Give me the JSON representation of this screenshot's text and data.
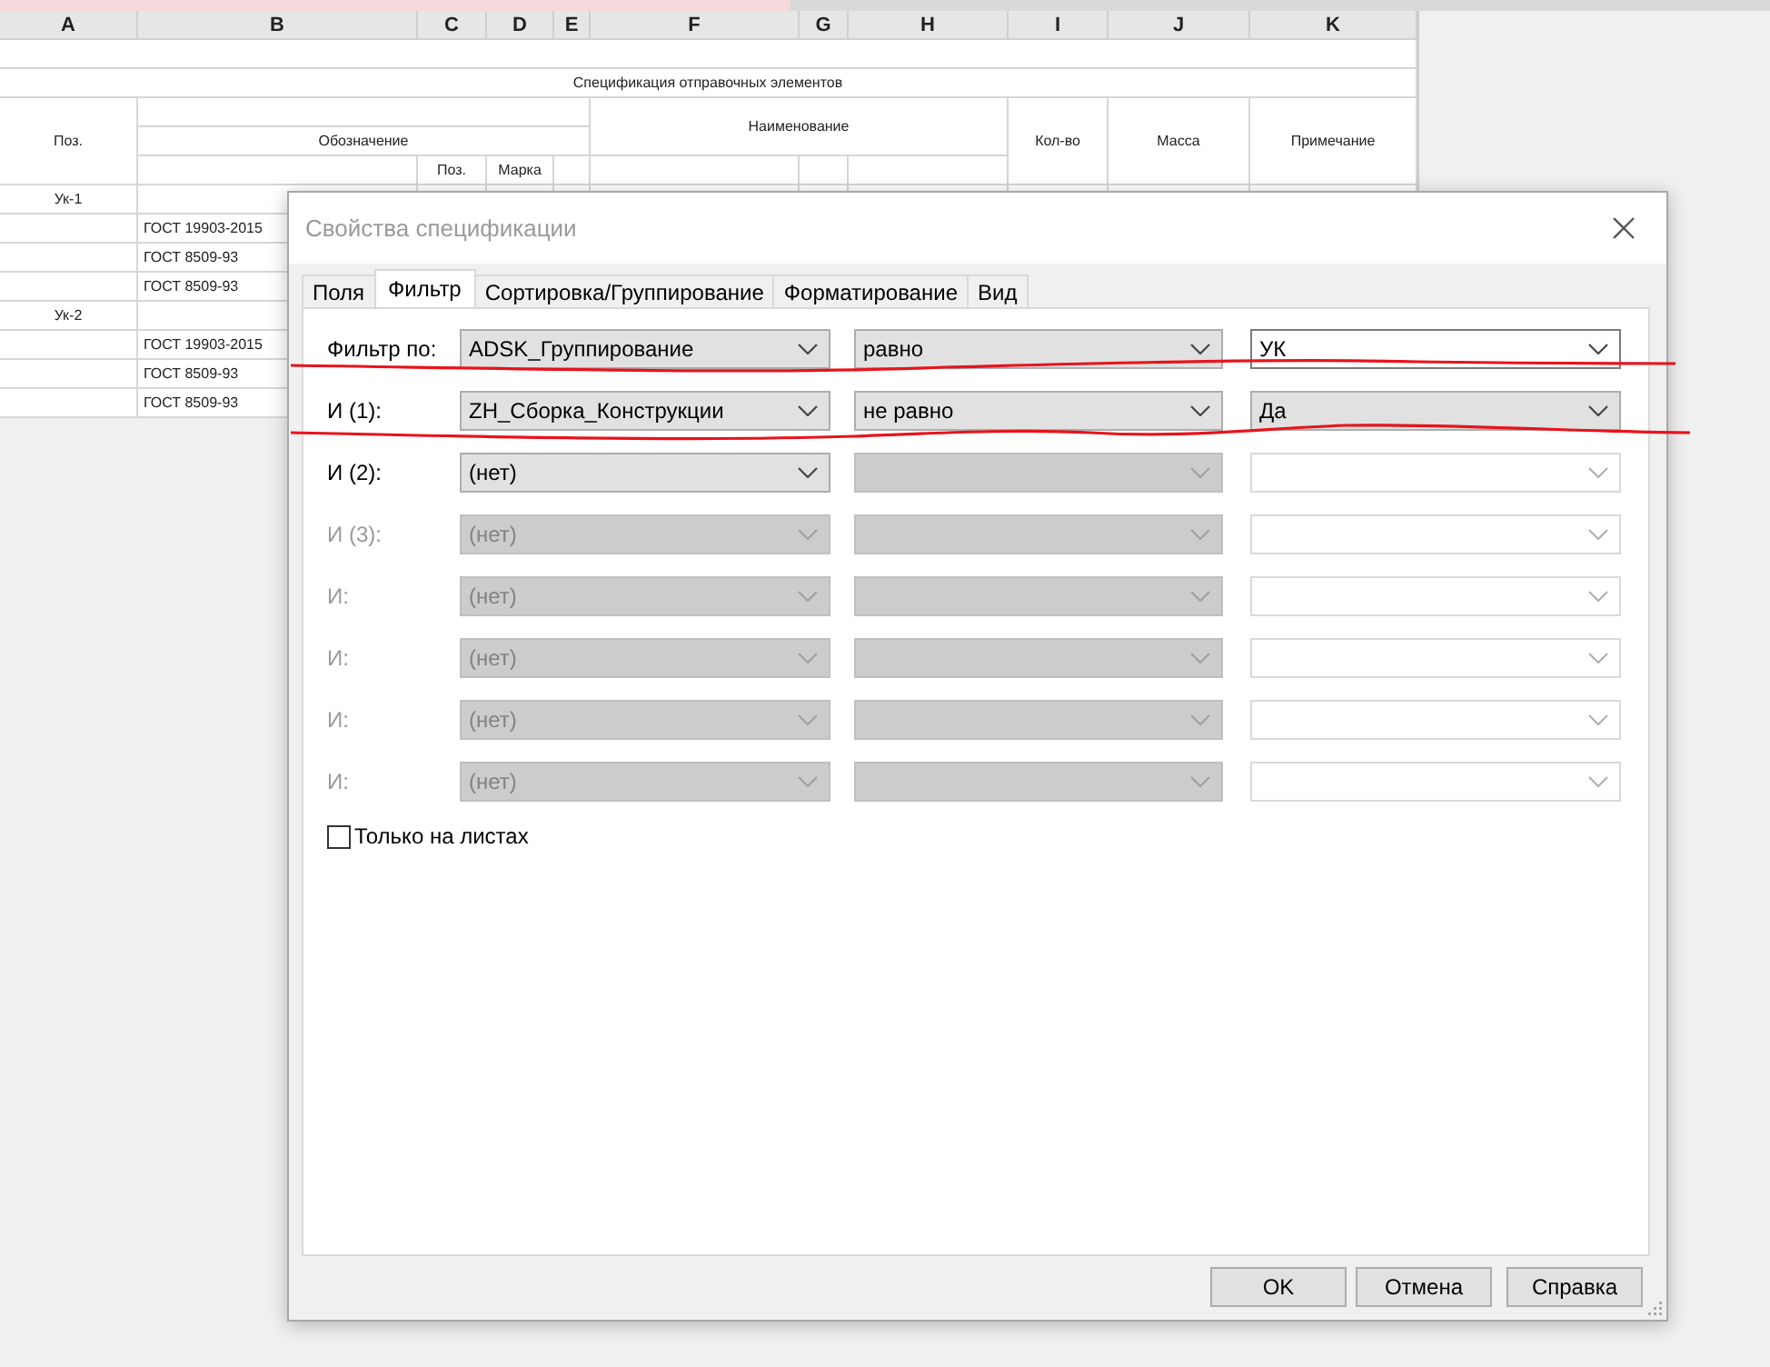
{
  "spreadsheet": {
    "columns": [
      "A",
      "B",
      "C",
      "D",
      "E",
      "F",
      "G",
      "H",
      "I",
      "J",
      "K"
    ],
    "title": "Спецификация отправочных элементов",
    "headers": {
      "position": "Поз.",
      "designation": "Обозначение",
      "name": "Наименование",
      "sub_position": "Поз.",
      "mark": "Марка",
      "quantity": "Кол-во",
      "mass": "Масса",
      "note": "Примечание"
    },
    "rows": [
      {
        "position": "Ук-1"
      },
      {
        "designation": "ГОСТ 19903-2015"
      },
      {
        "designation": "ГОСТ 8509-93"
      },
      {
        "designation": "ГОСТ 8509-93"
      },
      {
        "position": "Ук-2"
      },
      {
        "designation": "ГОСТ 19903-2015"
      },
      {
        "designation": "ГОСТ 8509-93"
      },
      {
        "designation": "ГОСТ 8509-93"
      }
    ]
  },
  "dialog": {
    "title": "Свойства спецификации",
    "tabs": [
      {
        "label": "Поля",
        "selected": false
      },
      {
        "label": "Фильтр",
        "selected": true
      },
      {
        "label": "Сортировка/Группирование",
        "selected": false
      },
      {
        "label": "Форматирование",
        "selected": false
      },
      {
        "label": "Вид",
        "selected": false
      }
    ],
    "filters": [
      {
        "label": "Фильтр по:",
        "disabled": false,
        "field": {
          "value": "ADSK_Группирование",
          "disabled": false
        },
        "operator": {
          "value": "равно",
          "disabled": false
        },
        "value": {
          "value": "УК",
          "disabled": false,
          "editable": true
        }
      },
      {
        "label": "И (1):",
        "disabled": false,
        "field": {
          "value": "ZH_Сборка_Конструкции",
          "disabled": false
        },
        "operator": {
          "value": "не равно",
          "disabled": false
        },
        "value": {
          "value": "Да",
          "disabled": false,
          "editable": false
        }
      },
      {
        "label": "И (2):",
        "disabled": false,
        "field": {
          "value": "(нет)",
          "disabled": false
        },
        "operator": {
          "disabled": true
        },
        "value": {
          "disabled": true
        }
      },
      {
        "label": "И (3):",
        "disabled": true,
        "field": {
          "value": "(нет)",
          "disabled": true
        },
        "operator": {
          "disabled": true
        },
        "value": {
          "disabled": true
        }
      },
      {
        "label": "И:",
        "disabled": true,
        "field": {
          "value": "(нет)",
          "disabled": true
        },
        "operator": {
          "disabled": true
        },
        "value": {
          "disabled": true
        }
      },
      {
        "label": "И:",
        "disabled": true,
        "field": {
          "value": "(нет)",
          "disabled": true
        },
        "operator": {
          "disabled": true
        },
        "value": {
          "disabled": true
        }
      },
      {
        "label": "И:",
        "disabled": true,
        "field": {
          "value": "(нет)",
          "disabled": true
        },
        "operator": {
          "disabled": true
        },
        "value": {
          "disabled": true
        }
      },
      {
        "label": "И:",
        "disabled": true,
        "field": {
          "value": "(нет)",
          "disabled": true
        },
        "operator": {
          "disabled": true
        },
        "value": {
          "disabled": true
        }
      }
    ],
    "sheets_only": {
      "label": "Только на листах",
      "checked": false
    },
    "buttons": [
      "OK",
      "Отмена",
      "Справка"
    ]
  }
}
